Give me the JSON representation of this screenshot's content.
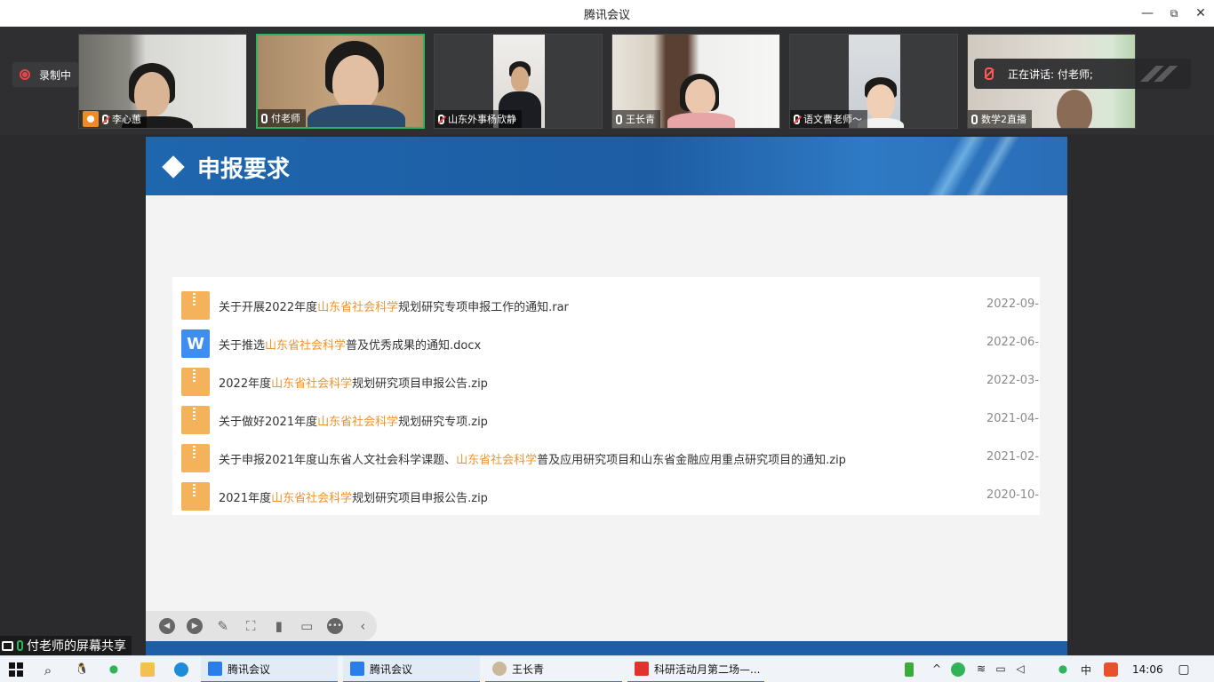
{
  "window": {
    "title": "腾讯会议",
    "minimize": "—",
    "restore": "⧉",
    "close": "✕"
  },
  "recording": {
    "label": "录制中"
  },
  "participants": [
    {
      "name": "李心蕙",
      "mic": "muted",
      "icon": "avatar-icon"
    },
    {
      "name": "付老师",
      "mic": "on",
      "active": true
    },
    {
      "name": "山东外事杨欣静",
      "mic": "muted"
    },
    {
      "name": "王长青",
      "mic": "on"
    },
    {
      "name": "语文曹老师～",
      "mic": "muted"
    },
    {
      "name": "数学2直播",
      "mic": "on"
    }
  ],
  "speaking": {
    "label": "正在讲话: 付老师;"
  },
  "slide": {
    "title": "申报要求",
    "files": [
      {
        "type": "zip",
        "prefix": "关于开展2022年度",
        "highlight": "山东省社会科学",
        "suffix": "规划研究专项申报工作的通知.rar",
        "date": "2022-09-.."
      },
      {
        "type": "doc",
        "prefix": "关于推选",
        "highlight": "山东省社会科学",
        "suffix": "普及优秀成果的通知.docx",
        "date": "2022-06-.."
      },
      {
        "type": "zip",
        "prefix": "2022年度",
        "highlight": "山东省社会科学",
        "suffix": "规划研究项目申报公告.zip",
        "date": "2022-03-.."
      },
      {
        "type": "zip",
        "prefix": "关于做好2021年度",
        "highlight": "山东省社会科学",
        "suffix": "规划研究专项.zip",
        "date": "2021-04-.."
      },
      {
        "type": "zip",
        "prefix": "关于申报2021年度山东省人文社会科学课题、",
        "highlight": "山东省社会科学",
        "suffix": "普及应用研究项目和山东省金融应用重点研究项目的通知.zip",
        "date": "2021-02-.."
      },
      {
        "type": "zip",
        "prefix": "2021年度",
        "highlight": "山东省社会科学",
        "suffix": "规划研究项目申报公告.zip",
        "date": "2020-10-.."
      }
    ],
    "doc_icon_letter": "W"
  },
  "share_label": "付老师的屏幕共享",
  "toolbar": {
    "prev": "◀",
    "next": "▶",
    "pen": "✎",
    "screenshot": "⛶",
    "camera": "▮",
    "chat": "▭",
    "more": "•••",
    "collapse": "‹"
  },
  "taskbar": {
    "apps": [
      {
        "label": "腾讯会议"
      },
      {
        "label": "腾讯会议"
      },
      {
        "label": "王长青"
      },
      {
        "label": "科研活动月第二场—..."
      }
    ],
    "ime": "中",
    "time": "14:06"
  },
  "colors": {
    "highlight": "#f0932b",
    "header_blue": "#1e66ae",
    "active_border": "#2fb45a",
    "zip_icon": "#f4b25a",
    "doc_icon": "#3d8ef0"
  }
}
